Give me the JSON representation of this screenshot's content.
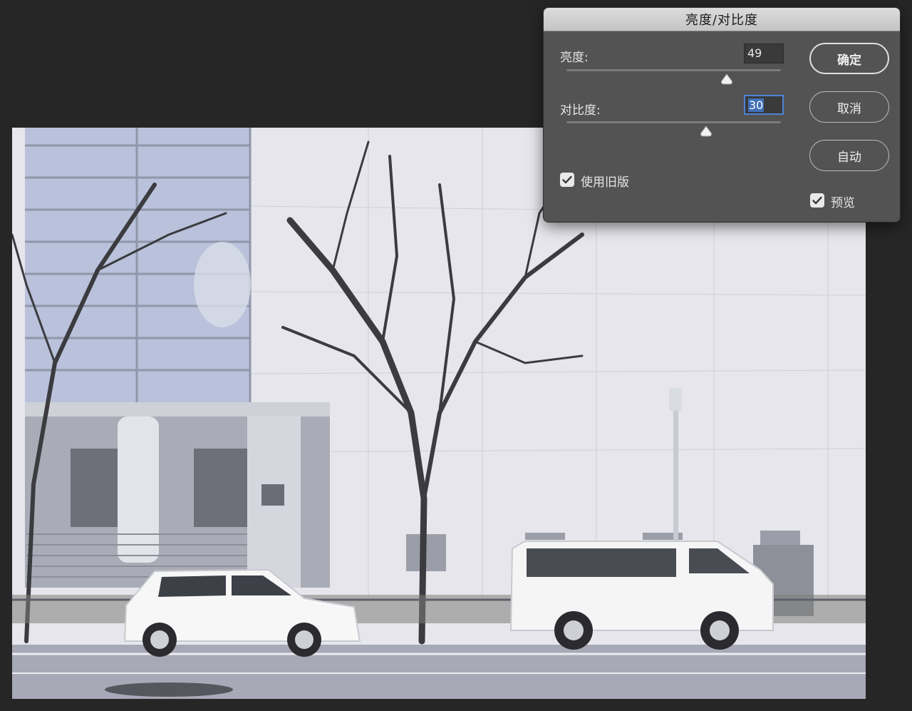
{
  "dialog": {
    "title": "亮度/对比度",
    "brightness": {
      "label": "亮度:",
      "value": "49",
      "level": 0.75
    },
    "contrast": {
      "label": "对比度:",
      "value": "30",
      "level": 0.65
    },
    "buttons": {
      "ok": "确定",
      "cancel": "取消",
      "auto": "自动"
    },
    "use_legacy": {
      "label": "使用旧版",
      "checked": true
    },
    "preview": {
      "label": "预览",
      "checked": true
    }
  },
  "icons": {
    "checkmark": "check-icon",
    "slider_thumb": "triangle-thumb-icon"
  },
  "colors": {
    "app_background": "#262626",
    "dialog_background": "#535353",
    "focus_ring": "#4d84d6"
  }
}
